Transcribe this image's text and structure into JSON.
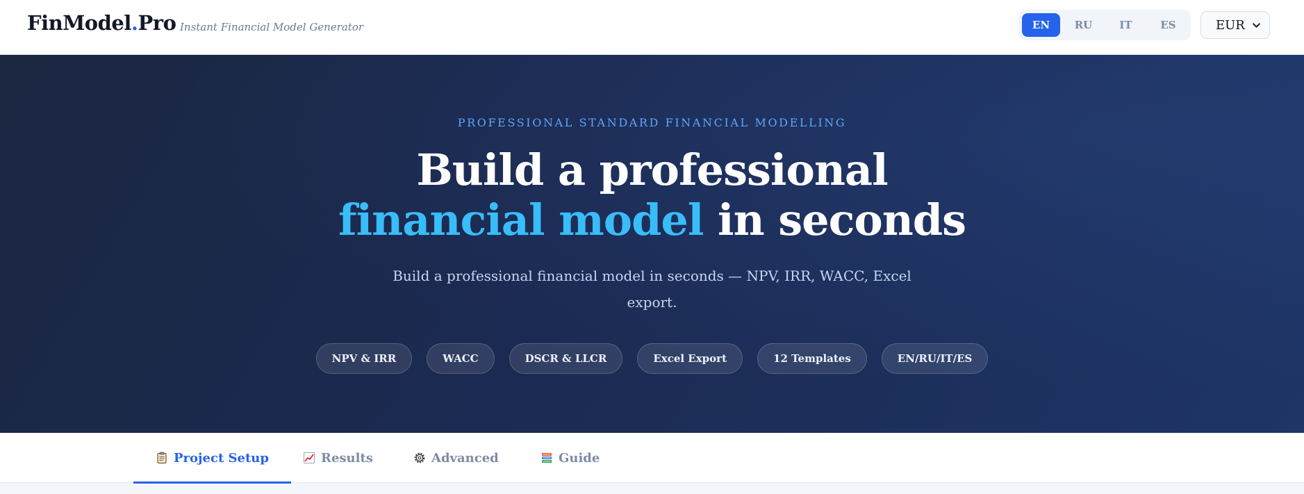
{
  "header": {
    "brand_main": "FinModel",
    "brand_dot": ".",
    "brand_suffix": "Pro",
    "tagline": "Instant Financial Model Generator",
    "languages": [
      {
        "label": "EN",
        "active": true
      },
      {
        "label": "RU",
        "active": false
      },
      {
        "label": "IT",
        "active": false
      },
      {
        "label": "ES",
        "active": false
      }
    ],
    "currency": "EUR"
  },
  "hero": {
    "eyebrow": "PROFESSIONAL STANDARD FINANCIAL MODELLING",
    "headline_line1": "Build a professional",
    "headline_accent": "financial model",
    "headline_rest": " in seconds",
    "subtitle": "Build a professional financial model in seconds — NPV, IRR, WACC, Excel export.",
    "chips": [
      "NPV & IRR",
      "WACC",
      "DSCR & LLCR",
      "Excel Export",
      "12 Templates",
      "EN/RU/IT/ES"
    ]
  },
  "tabs": [
    {
      "label": "Project Setup",
      "icon": "clipboard-icon",
      "active": true
    },
    {
      "label": "Results",
      "icon": "chart-icon",
      "active": false
    },
    {
      "label": "Advanced",
      "icon": "gear-icon",
      "active": false
    },
    {
      "label": "Guide",
      "icon": "book-icon",
      "active": false
    }
  ],
  "colors": {
    "accent": "#2563eb",
    "hero_accent": "#38bdf8",
    "hero_bg": "#1b2a52"
  }
}
